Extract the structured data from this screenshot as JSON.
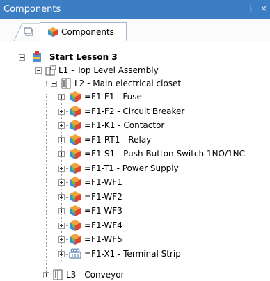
{
  "panel": {
    "title": "Components",
    "pin_glyph": "ᚿ",
    "close_glyph": "×"
  },
  "tabs": [
    {
      "label": "Components",
      "icon": "component-cube-icon",
      "selected": true
    }
  ],
  "tree": {
    "root": {
      "label": "Start Lesson 3",
      "icon": "project-icon",
      "expanded": true
    },
    "l1": {
      "label": "L1 - Top Level Assembly",
      "icon": "assembly-icon",
      "expanded": true
    },
    "l2": {
      "label": "L2 - Main electrical closet",
      "icon": "cabinet-icon",
      "expanded": true
    },
    "items": [
      {
        "label": "=F1-F1 - Fuse",
        "icon": "component-cube-icon"
      },
      {
        "label": "=F1-F2 - Circuit Breaker",
        "icon": "component-cube-icon"
      },
      {
        "label": "=F1-K1 - Contactor",
        "icon": "component-cube-icon"
      },
      {
        "label": "=F1-RT1 - Relay",
        "icon": "component-cube-icon"
      },
      {
        "label": "=F1-S1 - Push Button Switch 1NO/1NC",
        "icon": "component-cube-icon"
      },
      {
        "label": "=F1-T1 - Power Supply",
        "icon": "component-cube-icon"
      },
      {
        "label": "=F1-WF1",
        "icon": "component-cube-icon"
      },
      {
        "label": "=F1-WF2",
        "icon": "component-cube-icon"
      },
      {
        "label": "=F1-WF3",
        "icon": "component-cube-icon"
      },
      {
        "label": "=F1-WF4",
        "icon": "component-cube-icon"
      },
      {
        "label": "=F1-WF5",
        "icon": "component-cube-icon"
      },
      {
        "label": "=F1-X1 - Terminal Strip",
        "icon": "terminal-strip-icon"
      }
    ],
    "l3": {
      "label": "L3 - Conveyor",
      "icon": "cabinet-icon",
      "expanded": false
    }
  }
}
